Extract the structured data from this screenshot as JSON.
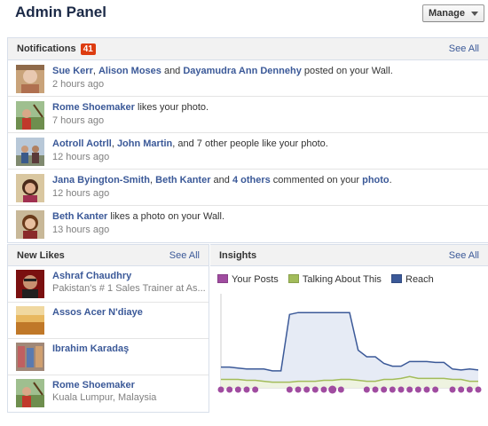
{
  "header": {
    "title": "Admin Panel",
    "manage_label": "Manage"
  },
  "notifications": {
    "title": "Notifications",
    "badge": "41",
    "see_all": "See All",
    "items": [
      {
        "actors": [
          "Sue Kerr",
          "Alison Moses"
        ],
        "sep1": ", ",
        "sep2": " and ",
        "actor3": "Dayamudra Ann Dennehy",
        "action": " posted on your Wall.",
        "time": "2 hours ago"
      },
      {
        "actor": "Rome Shoemaker",
        "action": " likes your photo.",
        "time": "7 hours ago"
      },
      {
        "actor1": "Aotroll Aotrll",
        "sep": ", ",
        "actor2": "John Martin",
        "action": ", and 7 other people like your photo.",
        "time": "12 hours ago"
      },
      {
        "actor1": "Jana Byington-Smith",
        "sep": ", ",
        "actor2": "Beth Kanter",
        "mid": " and ",
        "others": "4 others",
        "action": " commented on your ",
        "object": "photo",
        "end": ".",
        "time": "12 hours ago"
      },
      {
        "actor": "Beth Kanter",
        "action": " likes a photo on your Wall.",
        "time": "13 hours ago"
      }
    ]
  },
  "new_likes": {
    "title": "New Likes",
    "see_all": "See All",
    "items": [
      {
        "name": "Ashraf Chaudhry",
        "sub": "Pakistan's # 1 Sales Trainer at As..."
      },
      {
        "name": "Assos Acer N'diaye",
        "sub": ""
      },
      {
        "name": "Ibrahim Karadaş",
        "sub": ""
      },
      {
        "name": "Rome Shoemaker",
        "sub": "Kuala Lumpur, Malaysia"
      }
    ]
  },
  "insights": {
    "title": "Insights",
    "see_all": "See All",
    "legend": [
      "Your Posts",
      "Talking About This",
      "Reach"
    ],
    "colors": {
      "posts": "#a04ca0",
      "talking": "#a2bc5a",
      "reach": "#3b5998",
      "reach_fill": "#e6ebf5"
    }
  },
  "chart_data": {
    "type": "line",
    "series": [
      {
        "name": "Reach",
        "values": [
          0.22,
          0.22,
          0.21,
          0.2,
          0.2,
          0.2,
          0.18,
          0.18,
          0.78,
          0.8,
          0.8,
          0.8,
          0.8,
          0.8,
          0.8,
          0.8,
          0.4,
          0.33,
          0.33,
          0.26,
          0.23,
          0.23,
          0.28,
          0.28,
          0.28,
          0.27,
          0.27,
          0.2,
          0.19,
          0.2,
          0.19
        ]
      },
      {
        "name": "Talking About This",
        "values": [
          0.09,
          0.09,
          0.09,
          0.08,
          0.08,
          0.07,
          0.06,
          0.06,
          0.06,
          0.07,
          0.07,
          0.07,
          0.08,
          0.08,
          0.09,
          0.09,
          0.08,
          0.07,
          0.07,
          0.09,
          0.09,
          0.1,
          0.12,
          0.1,
          0.1,
          0.1,
          0.1,
          0.09,
          0.09,
          0.07,
          0.07
        ]
      },
      {
        "name": "Your Posts",
        "values": [
          1,
          1,
          1,
          1,
          1,
          0,
          0,
          0,
          1,
          1,
          1,
          1,
          1,
          2,
          1,
          0,
          0,
          1,
          1,
          1,
          1,
          1,
          1,
          1,
          1,
          1,
          0,
          1,
          1,
          1,
          1
        ]
      }
    ],
    "ylim": [
      0,
      1
    ]
  }
}
